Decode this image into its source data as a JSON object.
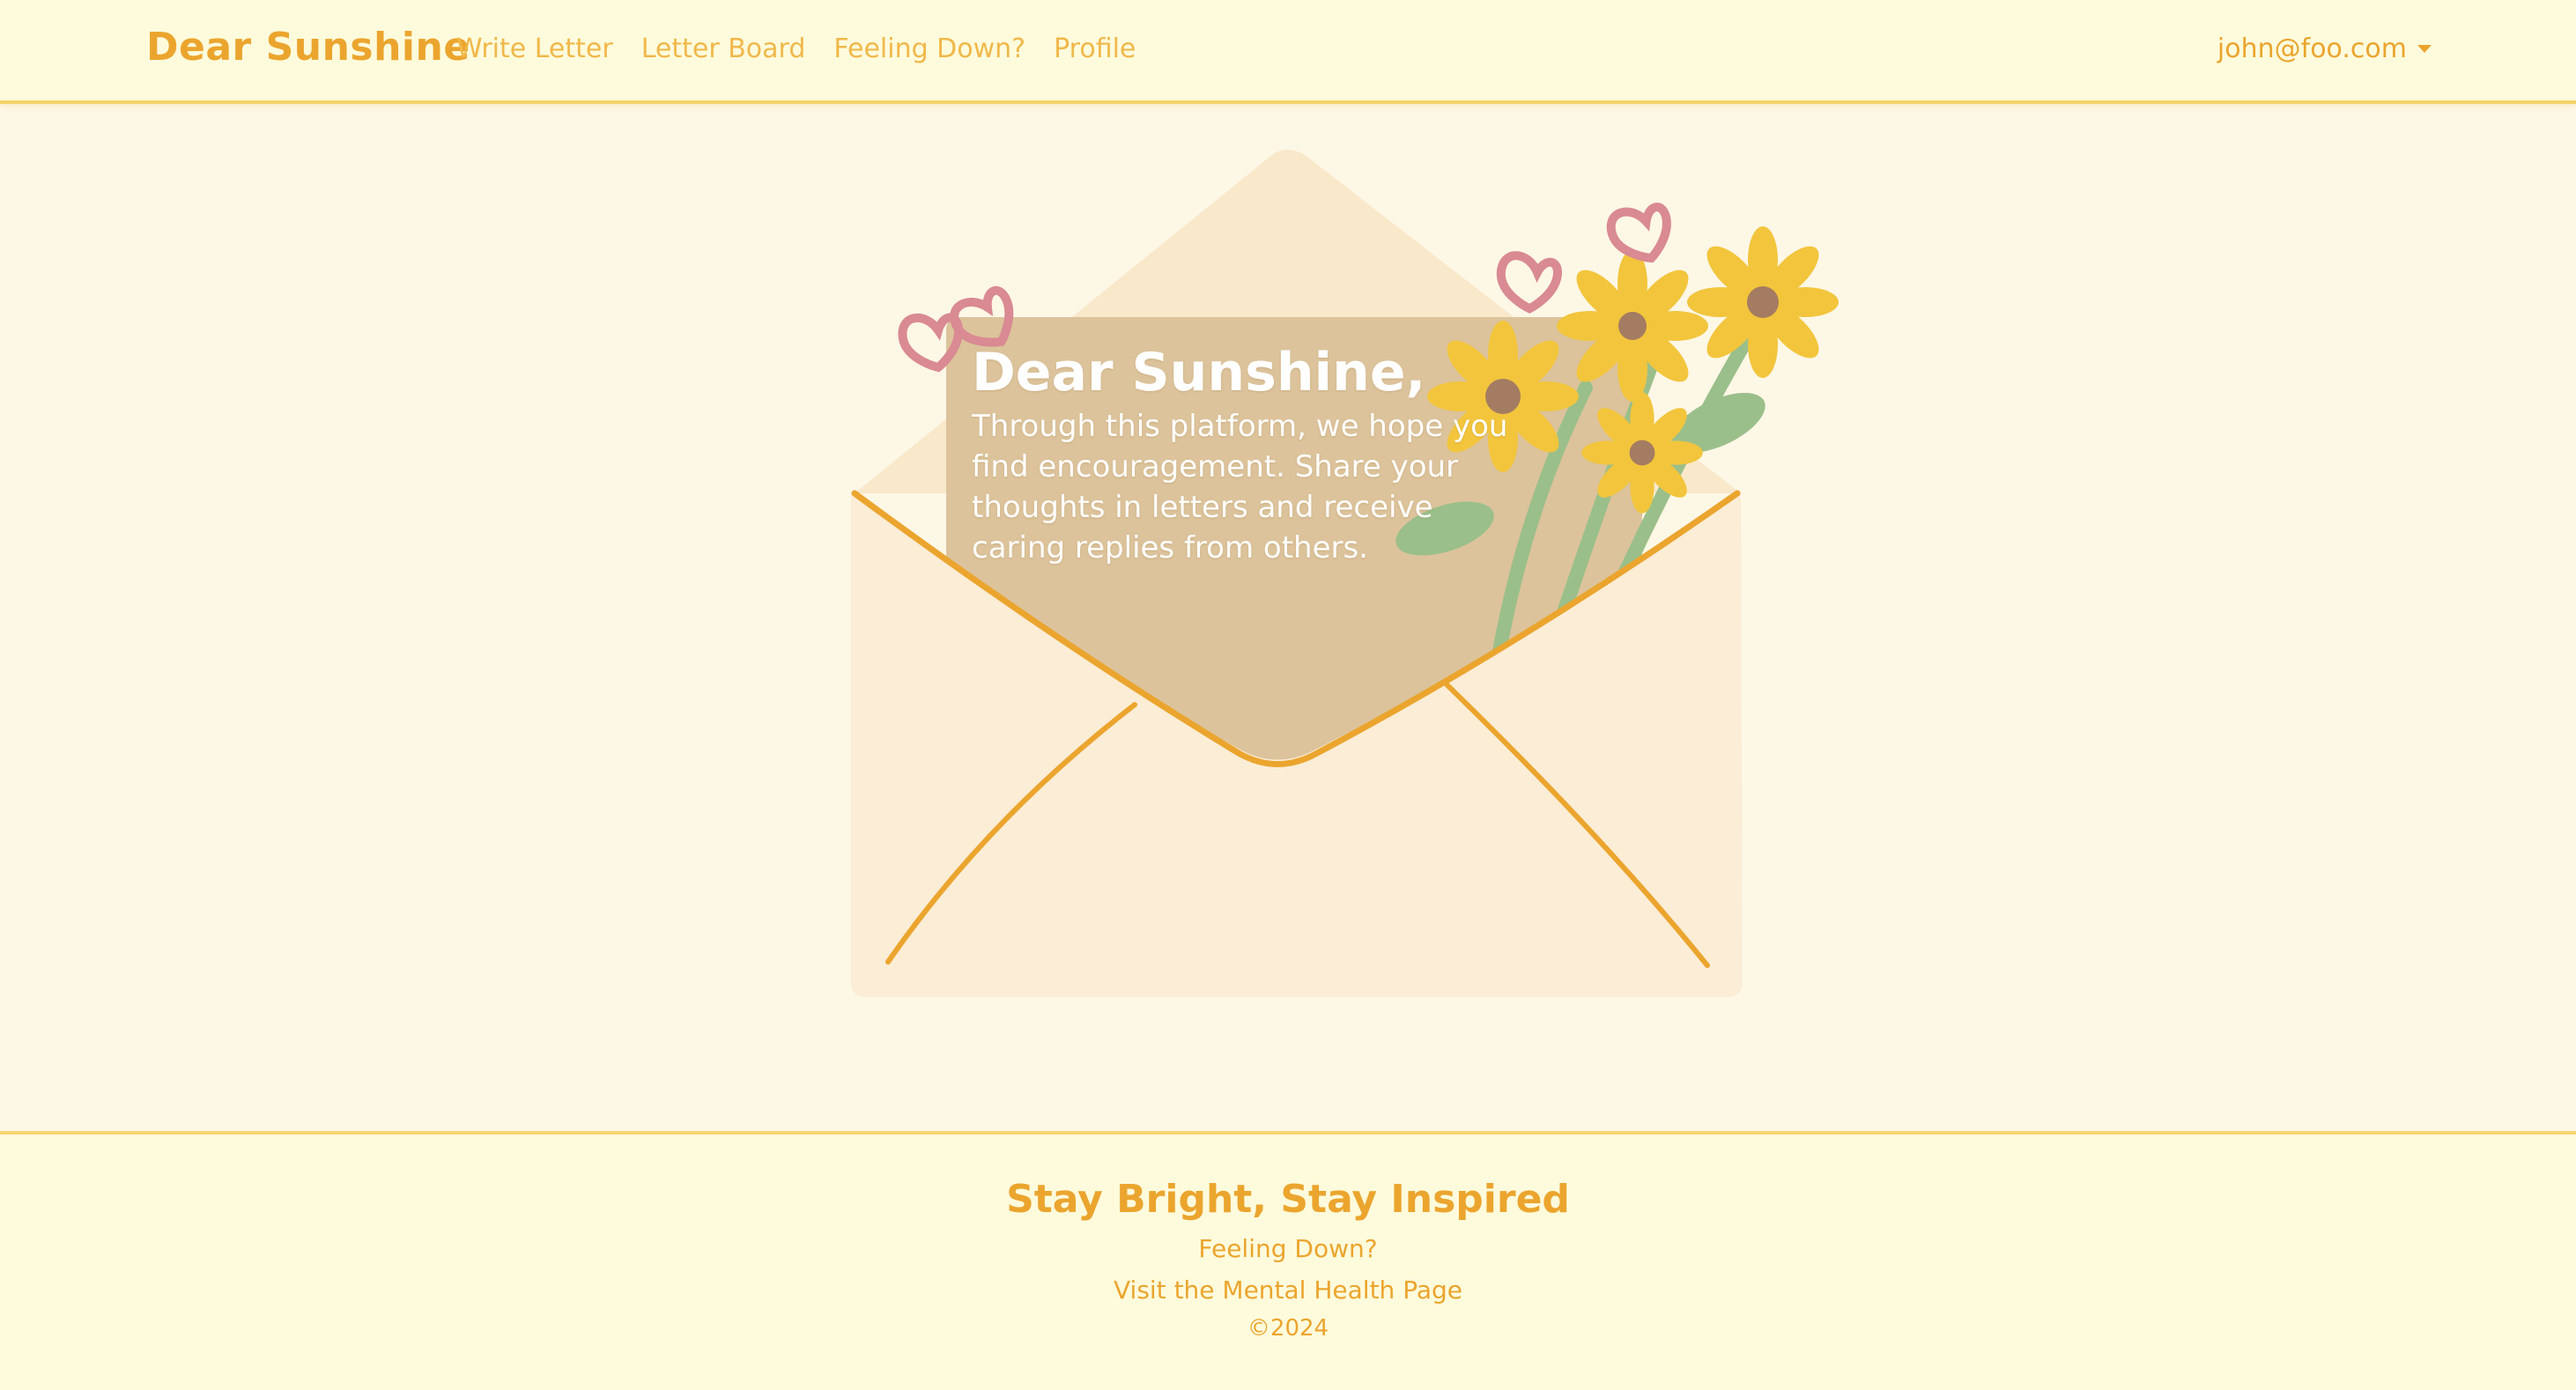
{
  "navbar": {
    "brand": "Dear Sunshine",
    "links": [
      {
        "label": "Write Letter"
      },
      {
        "label": "Letter Board"
      },
      {
        "label": "Feeling Down?"
      },
      {
        "label": "Profile"
      }
    ],
    "user": "john@foo.com"
  },
  "hero": {
    "title": "Dear Sunshine,",
    "body": "Through this platform, we hope you find encouragement. Share your thoughts in letters and receive caring replies from others."
  },
  "footer": {
    "title": "Stay Bright, Stay Inspired",
    "link1": "Feeling Down?",
    "link2": "Visit the Mental Health Page",
    "copyright": "©2024"
  },
  "colors": {
    "brand": "#eba52e",
    "nav_background": "#fefbdc",
    "page_background": "#fdf7e6",
    "envelope": "#f9ead0",
    "letter": "#dcc39b",
    "flower": "#f2c53c",
    "heart": "#d98a93",
    "leaf": "#9bbf8a"
  }
}
